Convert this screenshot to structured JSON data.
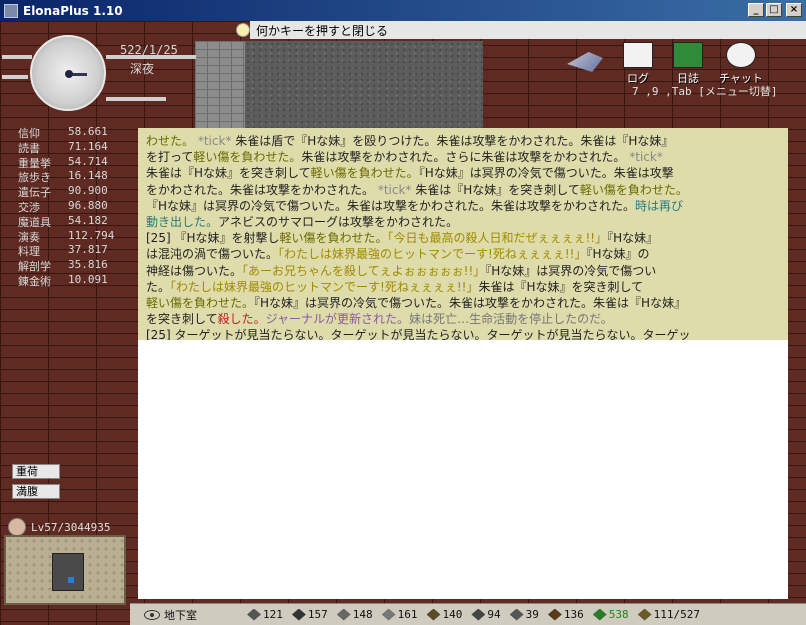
{
  "window": {
    "title": "ElonaPlus 1.10"
  },
  "prompt": {
    "text": "何かキーを押すと閉じる"
  },
  "clock": {
    "date": "522/1/25",
    "time_of_day": "深夜"
  },
  "menu": {
    "items": [
      {
        "label": "ログ",
        "icon": "quill-icon",
        "color": "#f2f2f2"
      },
      {
        "label": "日誌",
        "icon": "journal-icon",
        "color": "#2f8a3a"
      },
      {
        "label": "チャット",
        "icon": "chat-icon",
        "color": "#f2f2f2"
      }
    ],
    "hint": "7 ,9 ,Tab [メニュー切替]"
  },
  "skills": [
    {
      "name": "信仰",
      "value": "58.661"
    },
    {
      "name": "読書",
      "value": "71.164"
    },
    {
      "name": "重量挙",
      "value": "54.714"
    },
    {
      "name": "旅歩き",
      "value": "16.148"
    },
    {
      "name": "遺伝子",
      "value": "90.900"
    },
    {
      "name": "交渉",
      "value": "96.880"
    },
    {
      "name": "魔道具",
      "value": "54.182"
    },
    {
      "name": "演奏",
      "value": "112.794"
    },
    {
      "name": "料理",
      "value": "37.817"
    },
    {
      "name": "解剖学",
      "value": "35.816"
    },
    {
      "name": "錬金術",
      "value": "10.091"
    }
  ],
  "status": {
    "burden": "重荷",
    "hunger": "満腹"
  },
  "player": {
    "level": "Lv57/3044935"
  },
  "log": [
    [
      {
        "t": "わせた。",
        "c": "#6a6a00"
      },
      {
        "t": " *tick* ",
        "c": "#888"
      },
      {
        "t": "朱雀は盾で『Hな妹』を殴りつけた。朱雀は攻撃をかわされた。朱雀は『Hな妹』",
        "c": "#222"
      }
    ],
    [
      {
        "t": "を打って",
        "c": "#222"
      },
      {
        "t": "軽い傷を負わせた。",
        "c": "#6a6a00"
      },
      {
        "t": "朱雀は攻撃をかわされた。さらに朱雀は攻撃をかわされた。",
        "c": "#222"
      },
      {
        "t": " *tick*",
        "c": "#888"
      }
    ],
    [
      {
        "t": "朱雀は『Hな妹』を突き刺して",
        "c": "#222"
      },
      {
        "t": "軽い傷を負わせた。",
        "c": "#6a6a00"
      },
      {
        "t": "『Hな妹』は冥界の冷気で傷ついた。朱雀は攻撃",
        "c": "#222"
      }
    ],
    [
      {
        "t": "をかわされた。朱雀は攻撃をかわされた。",
        "c": "#222"
      },
      {
        "t": " *tick* ",
        "c": "#888"
      },
      {
        "t": "朱雀は『Hな妹』を突き刺して",
        "c": "#222"
      },
      {
        "t": "軽い傷を負わせた。",
        "c": "#6a6a00"
      }
    ],
    [
      {
        "t": "『Hな妹』は冥界の冷気で傷ついた。朱雀は攻撃をかわされた。朱雀は攻撃をかわされた。",
        "c": "#222"
      },
      {
        "t": "時は再び",
        "c": "#2a7a7a"
      }
    ],
    [
      {
        "t": "動き出した。",
        "c": "#2a7a7a"
      },
      {
        "t": "アネビスのサマローグは攻撃をかわされた。",
        "c": "#222"
      }
    ],
    [
      {
        "t": "[25] 『Hな妹』を射撃し",
        "c": "#222"
      },
      {
        "t": "軽い傷を負わせた。",
        "c": "#6a6a00"
      },
      {
        "t": "「今日も最高の殺人日和だぜぇぇぇぇ!!」",
        "c": "#a08a00"
      },
      {
        "t": "『Hな妹』",
        "c": "#222"
      }
    ],
    [
      {
        "t": "は混沌の渦で傷ついた。",
        "c": "#222"
      },
      {
        "t": "「わたしは妹界最強のヒットマンでーす!死ねぇぇぇぇ!!」",
        "c": "#a08a00"
      },
      {
        "t": "『Hな妹』の",
        "c": "#222"
      }
    ],
    [
      {
        "t": "神経は傷ついた。",
        "c": "#222"
      },
      {
        "t": "「あーお兄ちゃんを殺してぇよぉぉぉぉぉ!!」",
        "c": "#a08a00"
      },
      {
        "t": "『Hな妹』は冥界の冷気で傷つい",
        "c": "#222"
      }
    ],
    [
      {
        "t": "た。",
        "c": "#222"
      },
      {
        "t": "「わたしは妹界最強のヒットマンでーす!死ねぇぇぇぇ!!」",
        "c": "#a08a00"
      },
      {
        "t": "朱雀は『Hな妹』を突き刺して",
        "c": "#222"
      }
    ],
    [
      {
        "t": "軽い傷を負わせた。",
        "c": "#6a6a00"
      },
      {
        "t": "『Hな妹』は冥界の冷気で傷ついた。朱雀は攻撃をかわされた。朱雀は『Hな妹』",
        "c": "#222"
      }
    ],
    [
      {
        "t": "を突き刺して",
        "c": "#222"
      },
      {
        "t": "殺した。",
        "c": "#b22"
      },
      {
        "t": "ジャーナルが更新された。",
        "c": "#8a5aa0"
      },
      {
        "t": "妹は死亡…生命活動を停止したのだ。",
        "c": "#777"
      }
    ],
    [
      {
        "t": "[25] ターゲットが見当たらない。ターゲットが見当たらない。ターゲットが見当たらない。ターゲッ",
        "c": "#222"
      }
    ]
  ],
  "bottom_bar": {
    "location": "地下室",
    "stats": [
      {
        "icon": "sword-icon",
        "value": "121"
      },
      {
        "icon": "skull-icon",
        "value": "157"
      },
      {
        "icon": "arrow-icon",
        "value": "148"
      },
      {
        "icon": "wing-icon",
        "value": "161"
      },
      {
        "icon": "book-icon",
        "value": "140"
      },
      {
        "icon": "star-icon",
        "value": "94"
      },
      {
        "icon": "eye-ring-icon",
        "value": "39"
      },
      {
        "icon": "bird-icon",
        "value": "136"
      },
      {
        "icon": "leaf-icon",
        "value": "538",
        "highlight": true
      },
      {
        "icon": "shield-icon",
        "value": "111/527"
      }
    ]
  }
}
